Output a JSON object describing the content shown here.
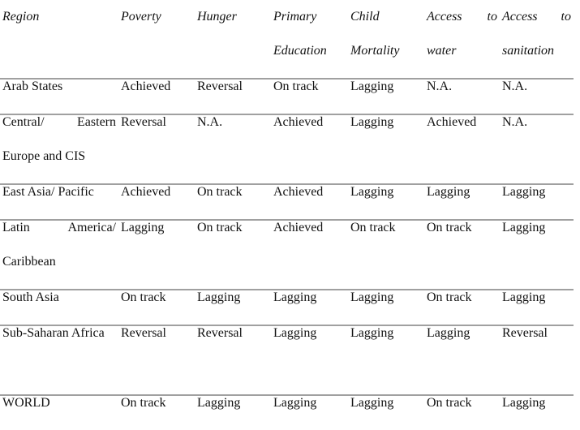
{
  "table": {
    "headers": [
      "Region",
      "Poverty",
      "Hunger",
      "Primary Education",
      "Child Mortality",
      "Access to water",
      "Access to sanitation"
    ],
    "rows": [
      [
        "Arab States",
        "Achieved",
        "Reversal",
        "On track",
        "Lagging",
        "N.A.",
        "N.A."
      ],
      [
        "Central/ Eastern Europe and CIS",
        "Reversal",
        "N.A.",
        "Achieved",
        "Lagging",
        "Achieved",
        "N.A."
      ],
      [
        "East Asia/ Pacific",
        "Achieved",
        "On track",
        "Achieved",
        "Lagging",
        "Lagging",
        "Lagging"
      ],
      [
        "Latin America/ Caribbean",
        "Lagging",
        "On track",
        "Achieved",
        "On track",
        "On track",
        "Lagging"
      ],
      [
        "South Asia",
        "On track",
        "Lagging",
        "Lagging",
        "Lagging",
        "On track",
        "Lagging"
      ],
      [
        "Sub-Saharan Africa",
        "Reversal",
        "Reversal",
        "Lagging",
        "Lagging",
        "Lagging",
        "Reversal"
      ],
      [
        "WORLD",
        "On track",
        "Lagging",
        "Lagging",
        "Lagging",
        "On track",
        "Lagging"
      ]
    ]
  }
}
